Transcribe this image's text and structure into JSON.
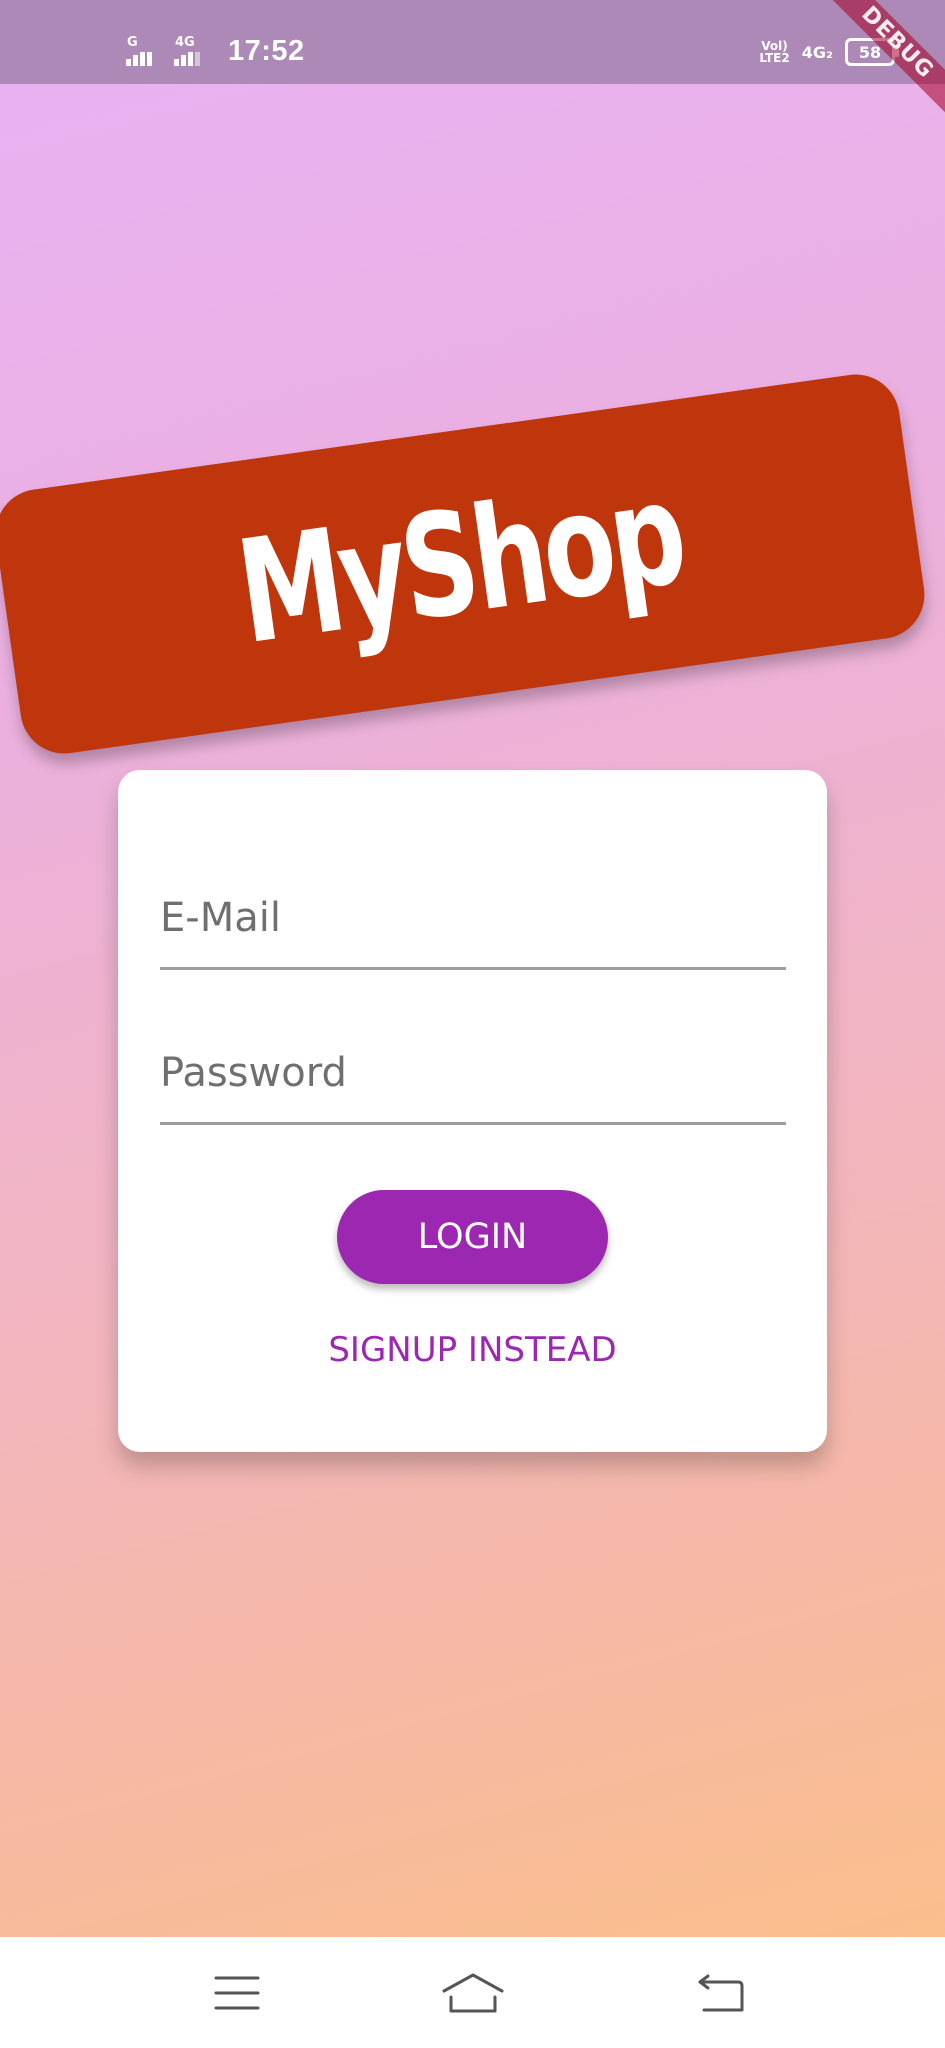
{
  "status_bar": {
    "signal1_label": "G",
    "signal2_label": "4G",
    "time": "17:52",
    "volte_line1": "Vol)",
    "volte_line2": "LTE2",
    "network_label": "4G₂",
    "battery_level": "58"
  },
  "debug_banner": {
    "label": "DEBUG"
  },
  "logo": {
    "text": "MyShop",
    "background_color": "#bf360c"
  },
  "auth_form": {
    "email": {
      "placeholder": "E-Mail",
      "value": ""
    },
    "password": {
      "placeholder": "Password",
      "value": ""
    },
    "login_label": "LOGIN",
    "signup_label": "SIGNUP INSTEAD",
    "accent_color": "#9c27b0"
  },
  "nav_bar": {
    "icons": [
      "menu-icon",
      "home-icon",
      "back-icon"
    ]
  }
}
